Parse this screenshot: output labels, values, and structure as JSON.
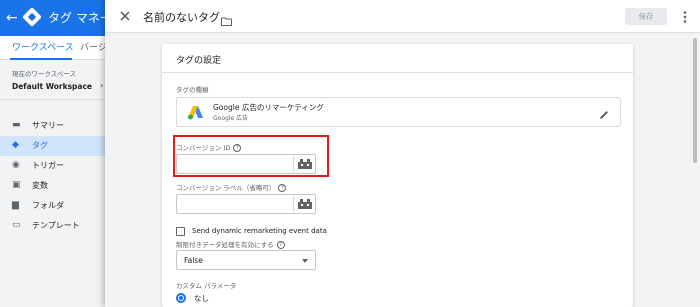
{
  "app": {
    "back_glyph": "←",
    "title": "タグ マネー",
    "tabs": [
      {
        "label": "ワークスペース"
      },
      {
        "label": "バージ"
      }
    ],
    "workspace_label": "現在のワークスペース",
    "workspace_name": "Default Workspace",
    "workspace_arrow": "›",
    "nav": [
      {
        "label": "サマリー",
        "icon": "summary-icon",
        "glyph": "▬"
      },
      {
        "label": "タグ",
        "icon": "tag-icon",
        "glyph": "◆"
      },
      {
        "label": "トリガー",
        "icon": "trigger-icon",
        "glyph": "◉"
      },
      {
        "label": "変数",
        "icon": "variable-icon",
        "glyph": "▣"
      },
      {
        "label": "フォルダ",
        "icon": "folder-icon",
        "glyph": "▆"
      },
      {
        "label": "テンプレート",
        "icon": "template-icon",
        "glyph": "▭"
      }
    ],
    "active_nav": "タグ"
  },
  "panel": {
    "title": "名前のないタグ",
    "save_label": "保存",
    "card": {
      "title": "タグの設定",
      "type_section_label": "タグの種類",
      "tag_type": {
        "name": "Google 広告のリマーケティング",
        "subtitle": "Google 広告"
      },
      "conversion_id": {
        "label": "コンバージョン ID",
        "value": ""
      },
      "conversion_label": {
        "label": "コンバージョン ラベル（省略可）",
        "value": ""
      },
      "dynamic_checkbox": {
        "label": "Send dynamic remarketing event data",
        "checked": false
      },
      "restricted_data": {
        "label": "制限付きデータ処理を有効にする",
        "value": "False"
      },
      "custom_params": {
        "label": "カスタム パラメータ",
        "option": "なし"
      }
    }
  },
  "colors": {
    "accent": "#1a73e8",
    "highlight": "#e31d1d"
  }
}
